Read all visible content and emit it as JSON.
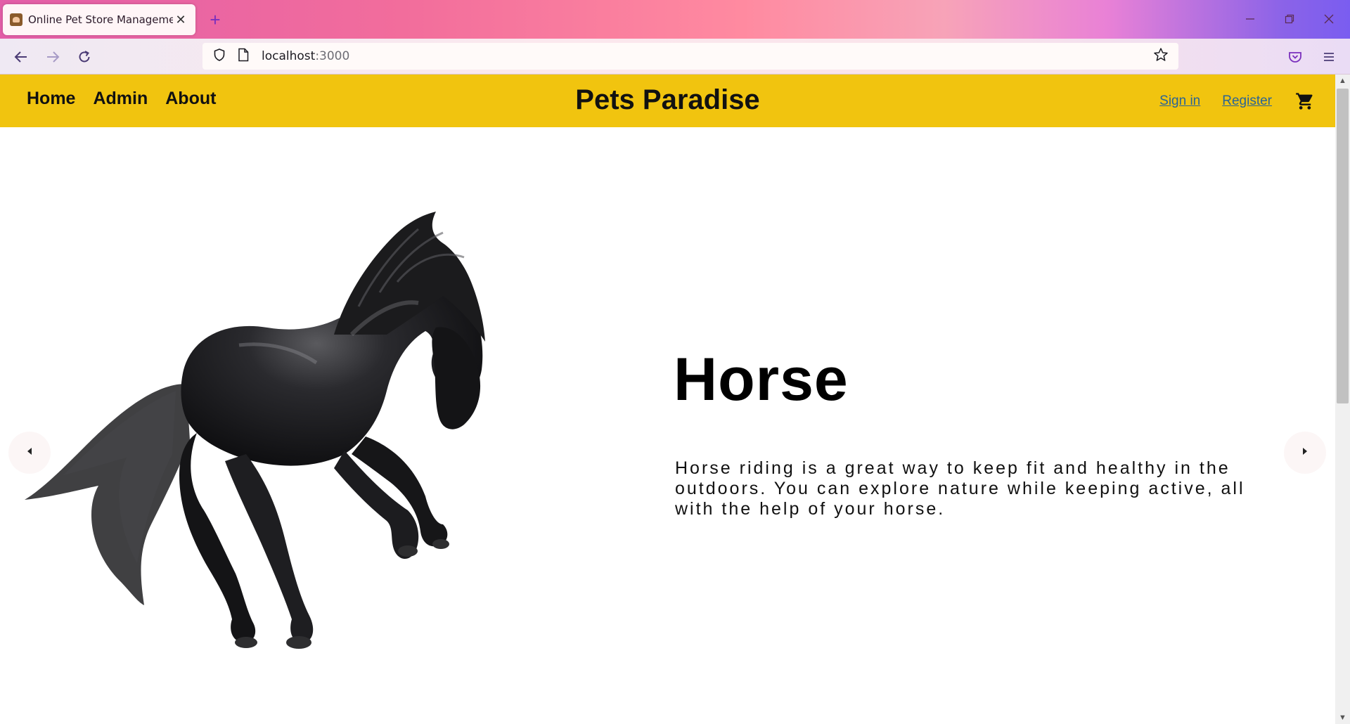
{
  "browser": {
    "tab_title": "Online Pet Store Management",
    "url_host": "localhost",
    "url_port": ":3000"
  },
  "site": {
    "nav": [
      "Home",
      "Admin",
      "About"
    ],
    "brand": "Pets Paradise",
    "sign_in": "Sign in",
    "register": "Register",
    "accent_color": "#f1c40f",
    "link_color": "#2a6496"
  },
  "hero": {
    "image_alt": "Black horse galloping",
    "title": "Horse",
    "description": "Horse riding is a great way to keep fit and healthy in the outdoors. You can explore nature while keeping active, all with the help of your horse."
  }
}
